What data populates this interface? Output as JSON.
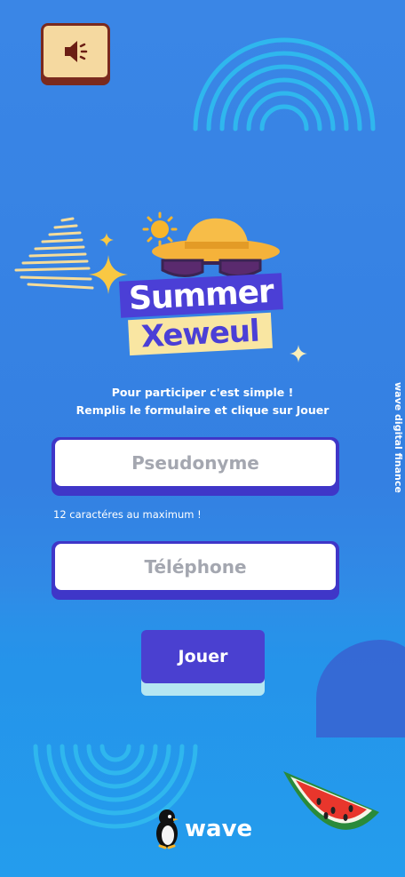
{
  "icons": {
    "sound": "speaker-icon",
    "brand_mascot": "penguin-icon"
  },
  "logo": {
    "line1": "Summer",
    "line2": "Xeweul"
  },
  "intro": {
    "line1": "Pour participer c'est simple !",
    "line2": "Remplis le formulaire et clique sur Jouer"
  },
  "form": {
    "pseudonym_placeholder": "Pseudonyme",
    "pseudonym_hint": "12 caractéres au maximum !",
    "phone_placeholder": "Téléphone",
    "submit_label": "Jouer"
  },
  "side_label": "wave digital finance",
  "brand": {
    "name": "wave"
  },
  "colors": {
    "background": "#3a86e6",
    "accent": "#4a40d0",
    "input_border": "#3f36c8",
    "placeholder": "#a4a7b0"
  }
}
